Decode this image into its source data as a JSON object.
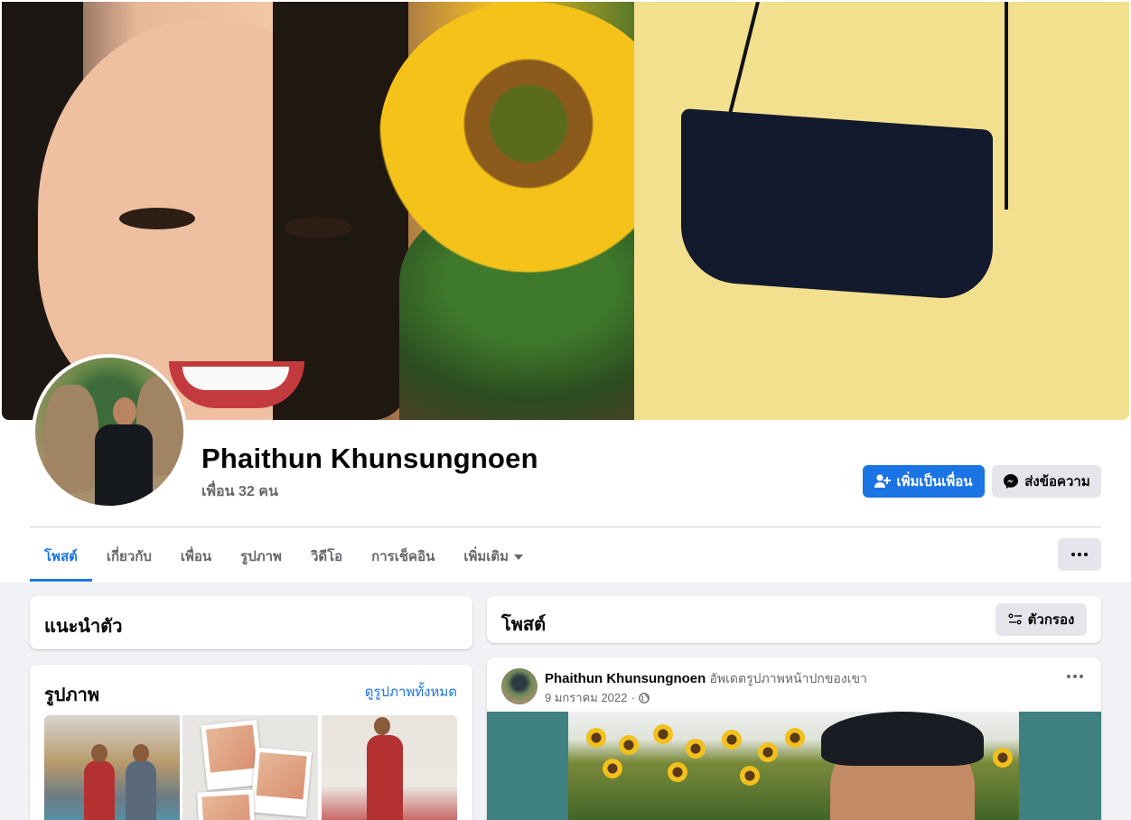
{
  "profile": {
    "name": "Phaithun Khunsungnoen",
    "friends": "เพื่อน 32 คน",
    "add_friend_label": "เพิ่มเป็นเพื่อน",
    "message_label": "ส่งข้อความ"
  },
  "tabs": [
    {
      "label": "โพสต์",
      "active": true
    },
    {
      "label": "เกี่ยวกับ"
    },
    {
      "label": "เพื่อน"
    },
    {
      "label": "รูปภาพ"
    },
    {
      "label": "วิดีโอ"
    },
    {
      "label": "การเช็คอิน"
    },
    {
      "label": "เพิ่มเติม"
    }
  ],
  "intro": {
    "title": "แนะนำตัว"
  },
  "photos": {
    "title": "รูปภาพ",
    "see_all": "ดูรูปภาพทั้งหมด"
  },
  "posts": {
    "title": "โพสต์",
    "filter_label": "ตัวกรอง",
    "items": [
      {
        "author": "Phaithun Khunsungnoen",
        "action": "อัพเดตรูปภาพหน้าปกของเขา",
        "date": "9 มกราคม 2022",
        "separator": "·",
        "privacy_icon": "globe-icon"
      }
    ]
  },
  "colors": {
    "accent": "#1b74e4",
    "background": "#f0f2f5",
    "secondary_button": "#e4e6eb",
    "muted_text": "#65676b"
  }
}
